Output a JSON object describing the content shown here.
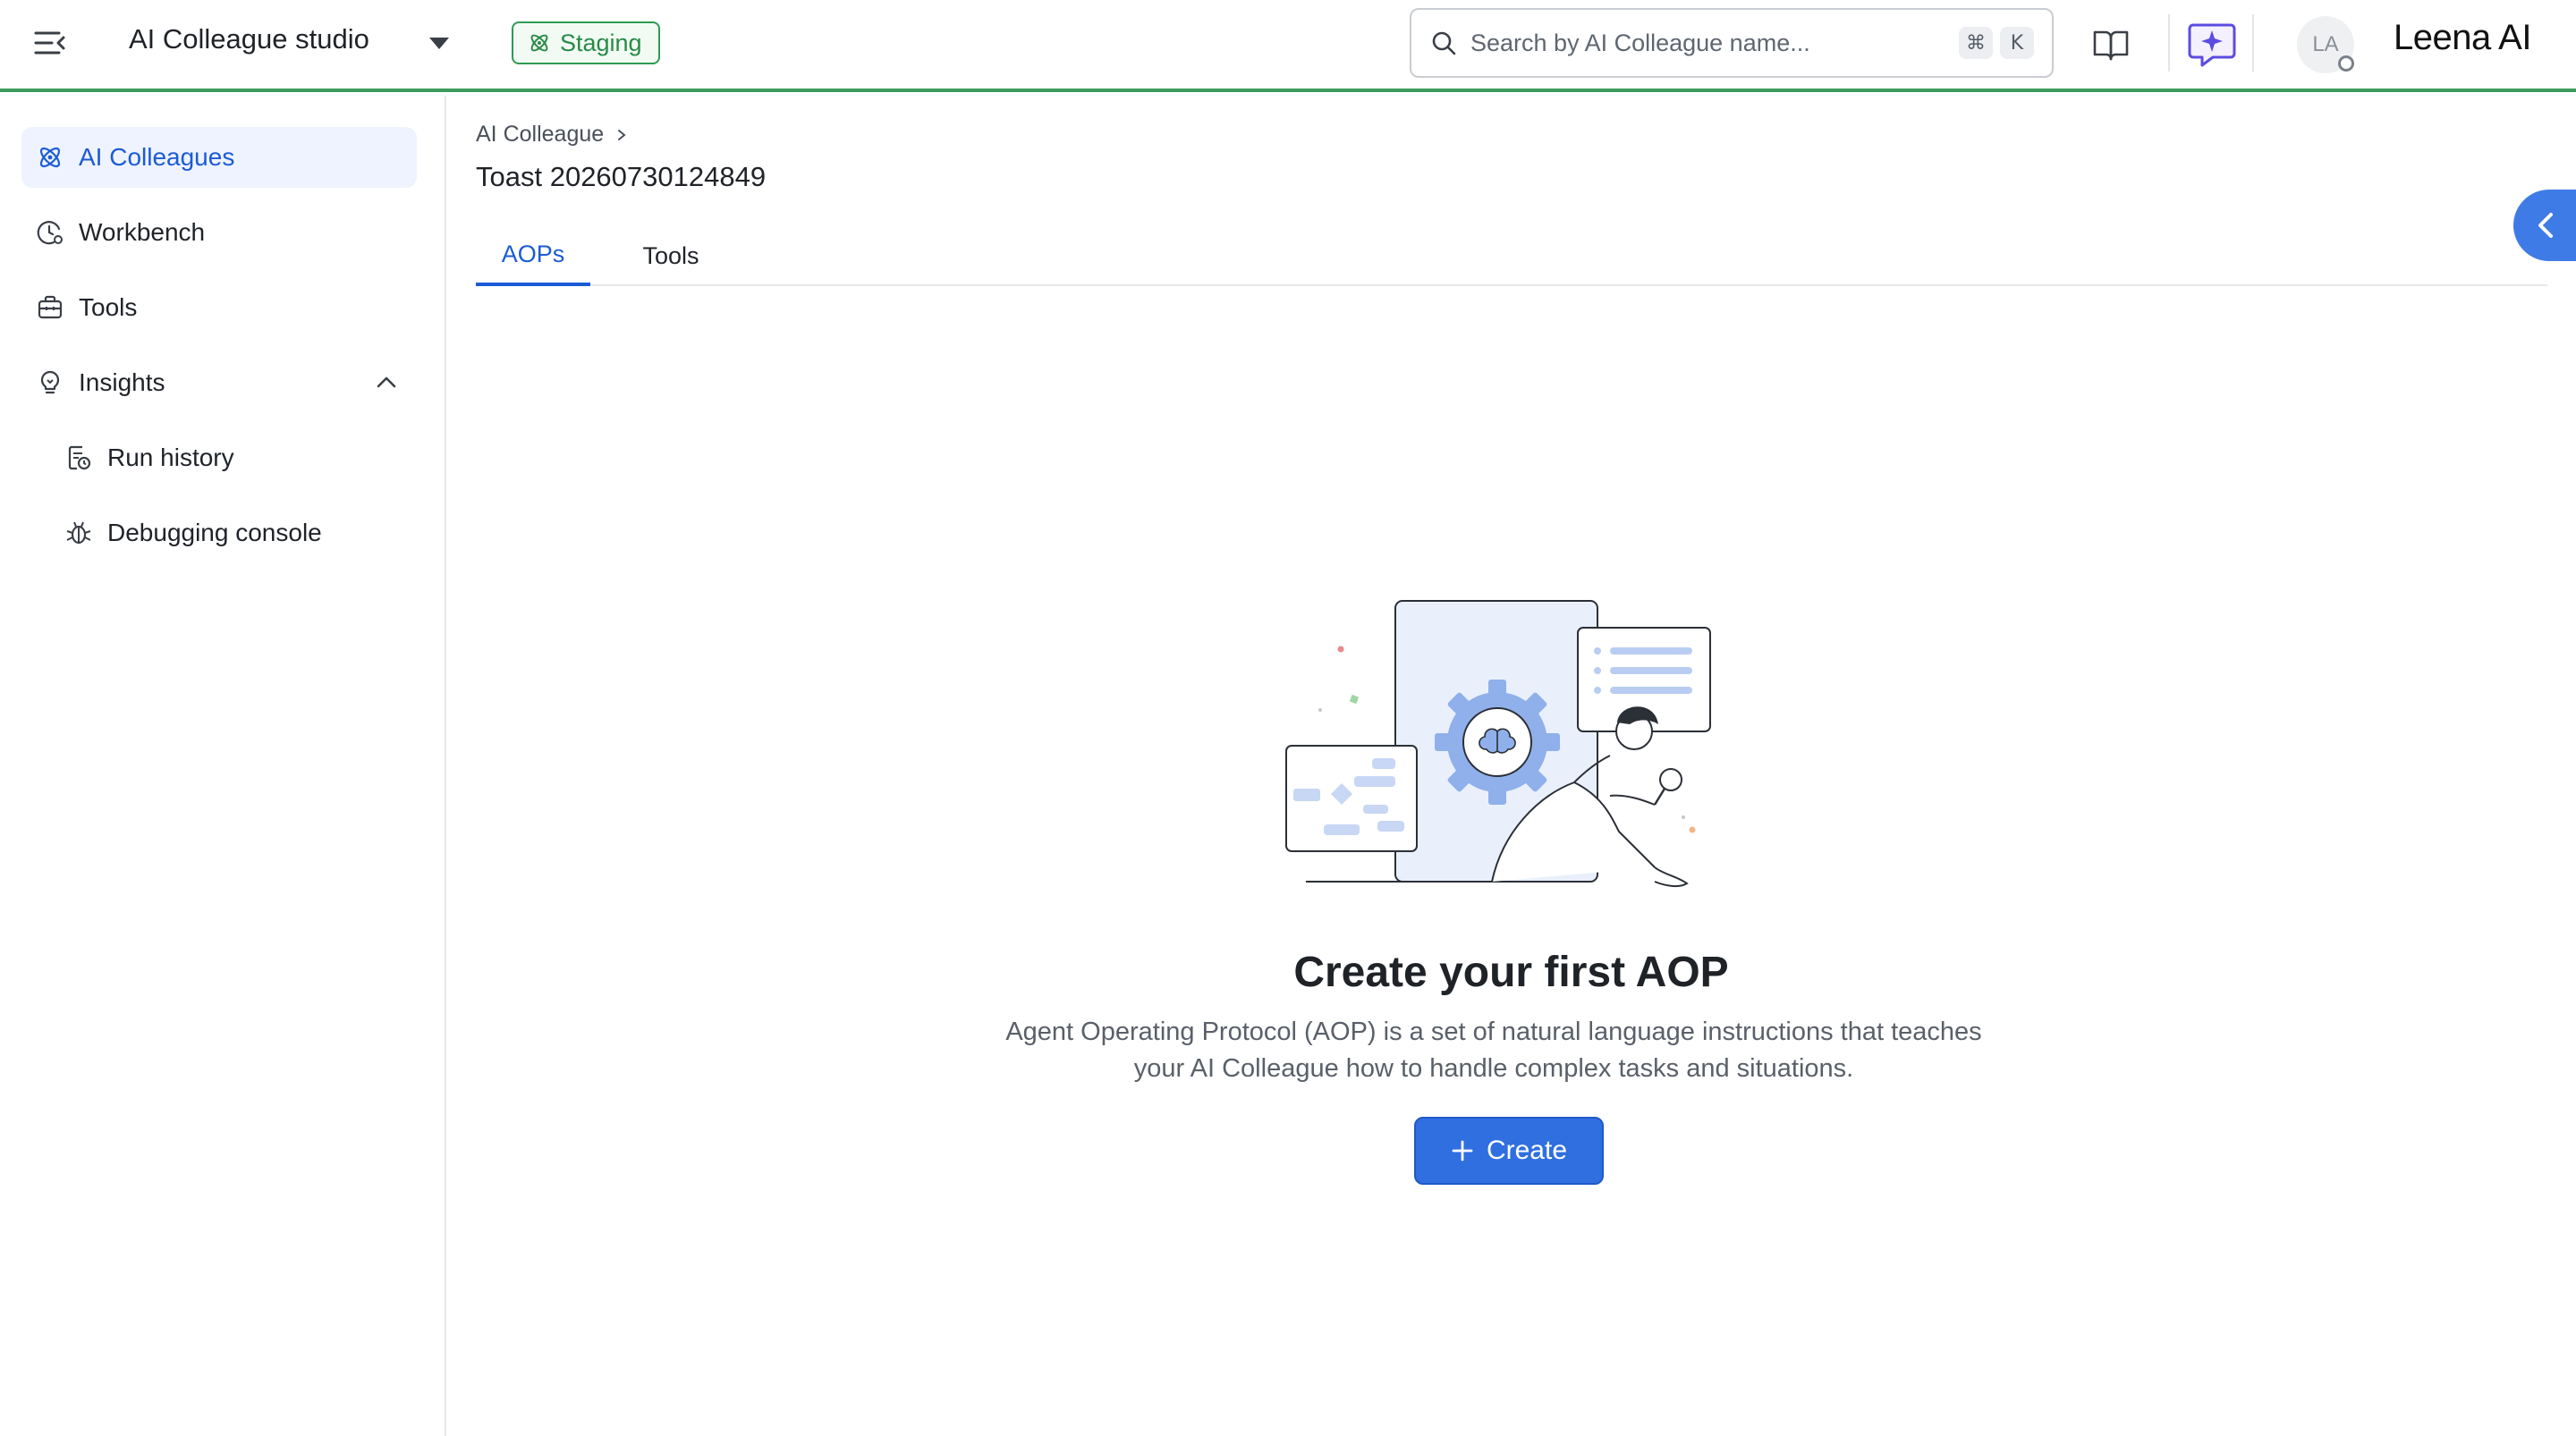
{
  "header": {
    "studio_title": "AI Colleague studio",
    "environment_badge": "Staging",
    "search": {
      "placeholder": "Search by AI Colleague name...",
      "shortcut_keys": [
        "⌘",
        "K"
      ]
    },
    "avatar_initials": "LA",
    "brand_name": "Leena AI",
    "accent_color": "#3d9a5b"
  },
  "sidebar": {
    "items": [
      {
        "label": "AI Colleagues",
        "icon": "atom-icon",
        "active": true
      },
      {
        "label": "Workbench",
        "icon": "clock-gear-icon",
        "active": false
      },
      {
        "label": "Tools",
        "icon": "toolbox-icon",
        "active": false
      },
      {
        "label": "Insights",
        "icon": "lightbulb-icon",
        "active": false,
        "expanded": true
      },
      {
        "label": "Run history",
        "icon": "history-doc-icon",
        "active": false
      },
      {
        "label": "Debugging console",
        "icon": "bug-icon",
        "active": false
      }
    ]
  },
  "main": {
    "breadcrumb": [
      "AI Colleague"
    ],
    "title": "Toast 20260730124849",
    "tabs": [
      {
        "label": "AOPs",
        "active": true
      },
      {
        "label": "Tools",
        "active": false
      }
    ],
    "empty_state": {
      "title": "Create your first AOP",
      "description_line1": "Agent Operating Protocol (AOP) is a set of natural language instructions that teaches",
      "description_line2": "your AI Colleague how to handle complex tasks and situations.",
      "button_label": "Create"
    }
  },
  "colors": {
    "primary": "#2f6fe0",
    "active_nav_bg": "#eef3ff",
    "staging_green": "#2e9b52"
  }
}
